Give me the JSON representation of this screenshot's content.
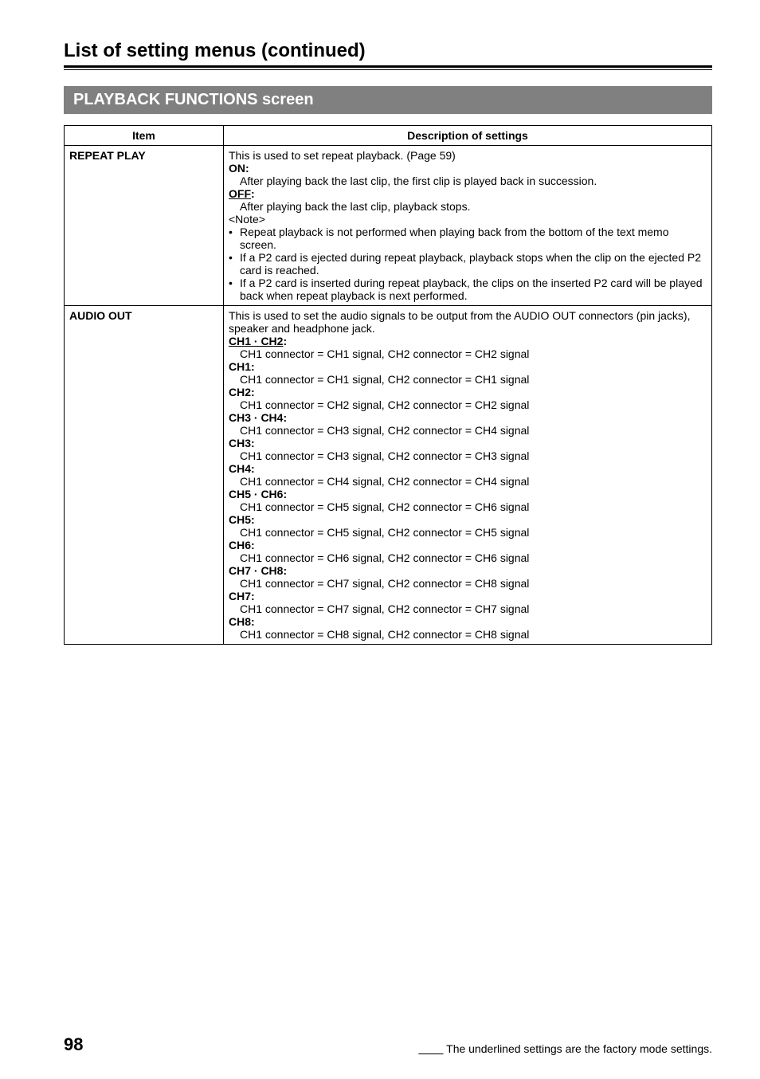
{
  "page": {
    "title": "List of setting menus (continued)",
    "sectionBar": "PLAYBACK FUNCTIONS screen"
  },
  "table": {
    "headers": {
      "item": "Item",
      "desc": "Description of settings"
    },
    "rows": [
      {
        "item": "REPEAT PLAY",
        "lines": [
          {
            "text": "This is used to set repeat playback. (Page 59)"
          },
          {
            "text": "ON:",
            "bold": true
          },
          {
            "text": "After playing back the last clip, the first clip is played back in succession.",
            "indent": true
          },
          {
            "text": "OFF",
            "bold": true,
            "underline": true,
            "trailingColon": ":"
          },
          {
            "text": "After playing back the last clip, playback stops.",
            "indent": true
          },
          {
            "text": "<Note>"
          },
          {
            "bullet": true,
            "text": "Repeat playback is not performed when playing back from the bottom of the text memo screen."
          },
          {
            "bullet": true,
            "text": "If a P2 card is ejected during repeat playback, playback stops when the clip on the ejected P2 card is reached."
          },
          {
            "bullet": true,
            "text": "If a P2 card is inserted during repeat playback, the clips on the inserted P2 card will be played back when repeat playback is next performed."
          }
        ]
      },
      {
        "item": "AUDIO OUT",
        "lines": [
          {
            "text": "This is used to set the audio signals to be output from the AUDIO OUT connectors (pin jacks), speaker and headphone jack."
          },
          {
            "text": "CH1 · CH2",
            "bold": true,
            "underline": true,
            "trailingColon": ":"
          },
          {
            "text": "CH1 connector = CH1 signal, CH2 connector = CH2 signal",
            "indent": true
          },
          {
            "text": "CH1:",
            "bold": true
          },
          {
            "text": "CH1 connector = CH1 signal, CH2 connector = CH1 signal",
            "indent": true
          },
          {
            "text": "CH2:",
            "bold": true
          },
          {
            "text": "CH1 connector = CH2 signal, CH2 connector = CH2 signal",
            "indent": true
          },
          {
            "text": "CH3 · CH4:",
            "bold": true
          },
          {
            "text": "CH1 connector = CH3 signal, CH2 connector = CH4 signal",
            "indent": true
          },
          {
            "text": "CH3:",
            "bold": true
          },
          {
            "text": "CH1 connector = CH3 signal, CH2 connector = CH3 signal",
            "indent": true
          },
          {
            "text": "CH4:",
            "bold": true
          },
          {
            "text": "CH1 connector = CH4 signal, CH2 connector = CH4 signal",
            "indent": true
          },
          {
            "text": "CH5 · CH6:",
            "bold": true
          },
          {
            "text": "CH1 connector = CH5 signal, CH2 connector = CH6 signal",
            "indent": true
          },
          {
            "text": "CH5:",
            "bold": true
          },
          {
            "text": "CH1 connector = CH5 signal, CH2 connector = CH5 signal",
            "indent": true
          },
          {
            "text": "CH6:",
            "bold": true
          },
          {
            "text": "CH1 connector = CH6 signal, CH2 connector = CH6 signal",
            "indent": true
          },
          {
            "text": "CH7 · CH8:",
            "bold": true
          },
          {
            "text": "CH1 connector = CH7 signal, CH2 connector = CH8 signal",
            "indent": true
          },
          {
            "text": "CH7:",
            "bold": true
          },
          {
            "text": "CH1 connector = CH7 signal, CH2 connector = CH7 signal",
            "indent": true
          },
          {
            "text": "CH8:",
            "bold": true
          },
          {
            "text": "CH1 connector = CH8 signal, CH2 connector = CH8 signal",
            "indent": true
          }
        ]
      }
    ]
  },
  "footer": {
    "pageNumber": "98",
    "note": " The underlined settings are the factory mode settings."
  }
}
